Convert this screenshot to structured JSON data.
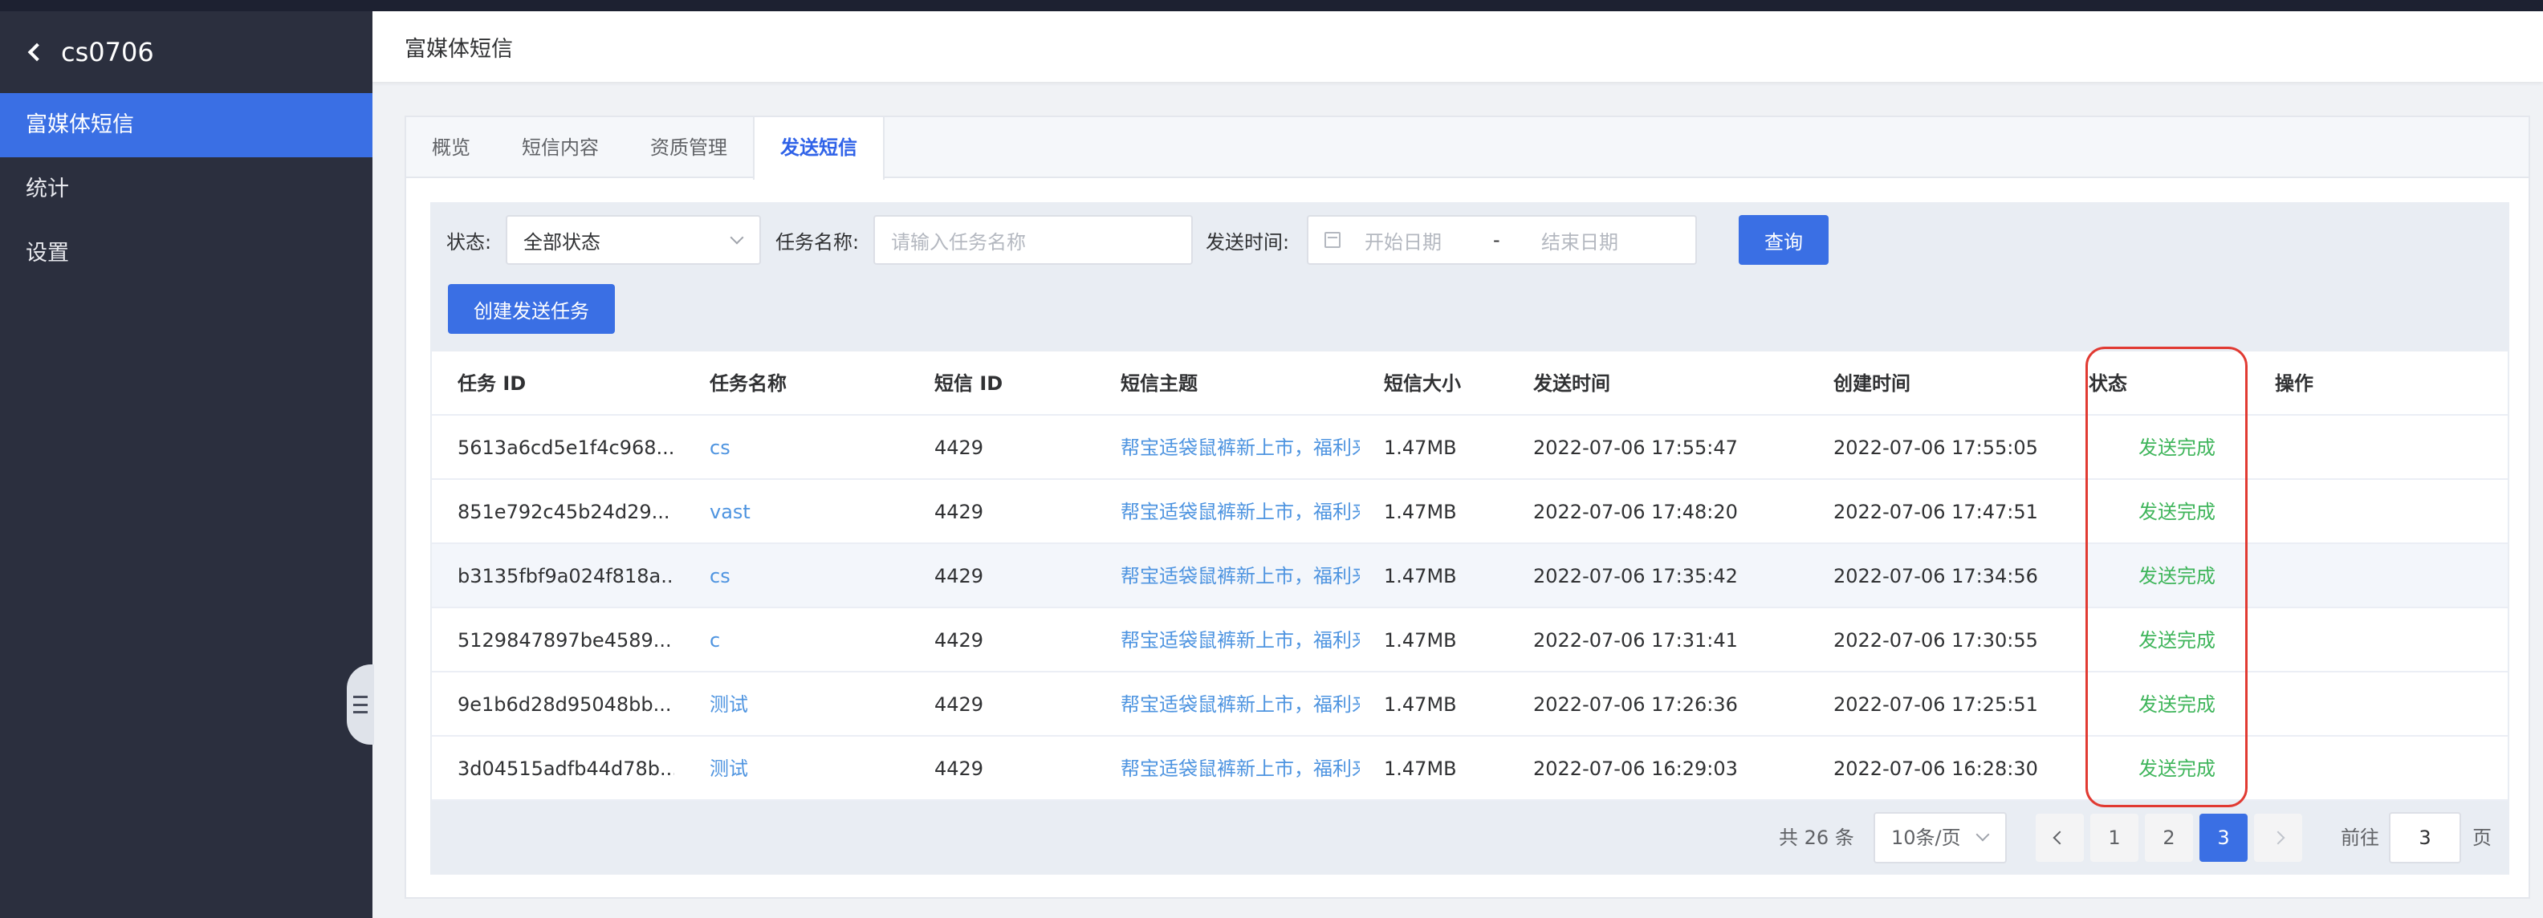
{
  "sidebar": {
    "title": "cs0706",
    "items": [
      {
        "label": "富媒体短信",
        "active": true
      },
      {
        "label": "统计",
        "active": false
      },
      {
        "label": "设置",
        "active": false
      }
    ]
  },
  "header": {
    "title": "富媒体短信"
  },
  "tabs": [
    {
      "label": "概览",
      "active": false
    },
    {
      "label": "短信内容",
      "active": false
    },
    {
      "label": "资质管理",
      "active": false
    },
    {
      "label": "发送短信",
      "active": true
    }
  ],
  "filters": {
    "status_label": "状态:",
    "status_value": "全部状态",
    "task_name_label": "任务名称:",
    "task_name_placeholder": "请输入任务名称",
    "send_time_label": "发送时间:",
    "start_date_placeholder": "开始日期",
    "date_separator": "-",
    "end_date_placeholder": "结束日期",
    "query_button": "查询",
    "create_button": "创建发送任务"
  },
  "table": {
    "columns": [
      "任务 ID",
      "任务名称",
      "短信 ID",
      "短信主题",
      "短信大小",
      "发送时间",
      "创建时间",
      "状态",
      "操作"
    ],
    "rows": [
      {
        "task_id": "5613a6cd5e1f4c968...",
        "task_name": "cs",
        "sms_id": "4429",
        "subject": "帮宝适袋鼠裤新上市，福利来",
        "size": "1.47MB",
        "send_time": "2022-07-06 17:55:47",
        "create_time": "2022-07-06 17:55:05",
        "status": "发送完成"
      },
      {
        "task_id": "851e792c45b24d29...",
        "task_name": "vast",
        "sms_id": "4429",
        "subject": "帮宝适袋鼠裤新上市，福利来",
        "size": "1.47MB",
        "send_time": "2022-07-06 17:48:20",
        "create_time": "2022-07-06 17:47:51",
        "status": "发送完成"
      },
      {
        "task_id": "b3135fbf9a024f818a...",
        "task_name": "cs",
        "sms_id": "4429",
        "subject": "帮宝适袋鼠裤新上市，福利来",
        "size": "1.47MB",
        "send_time": "2022-07-06 17:35:42",
        "create_time": "2022-07-06 17:34:56",
        "status": "发送完成"
      },
      {
        "task_id": "5129847897be4589...",
        "task_name": "c",
        "sms_id": "4429",
        "subject": "帮宝适袋鼠裤新上市，福利来",
        "size": "1.47MB",
        "send_time": "2022-07-06 17:31:41",
        "create_time": "2022-07-06 17:30:55",
        "status": "发送完成"
      },
      {
        "task_id": "9e1b6d28d95048bb...",
        "task_name": "测试",
        "sms_id": "4429",
        "subject": "帮宝适袋鼠裤新上市，福利来",
        "size": "1.47MB",
        "send_time": "2022-07-06 17:26:36",
        "create_time": "2022-07-06 17:25:51",
        "status": "发送完成"
      },
      {
        "task_id": "3d04515adfb44d78b...",
        "task_name": "测试",
        "sms_id": "4429",
        "subject": "帮宝适袋鼠裤新上市，福利来",
        "size": "1.47MB",
        "send_time": "2022-07-06 16:29:03",
        "create_time": "2022-07-06 16:28:30",
        "status": "发送完成"
      }
    ]
  },
  "pagination": {
    "total": "共 26 条",
    "page_size": "10条/页",
    "pages": [
      "1",
      "2",
      "3"
    ],
    "current_page": "3",
    "goto_label": "前往",
    "goto_value": "3",
    "page_unit": "页"
  },
  "colors": {
    "primary": "#3a6fe4",
    "sidebar_bg": "#2b2f3e",
    "link": "#4e94e0",
    "status_success": "#3fb55b",
    "highlight_frame": "#e13a32"
  }
}
